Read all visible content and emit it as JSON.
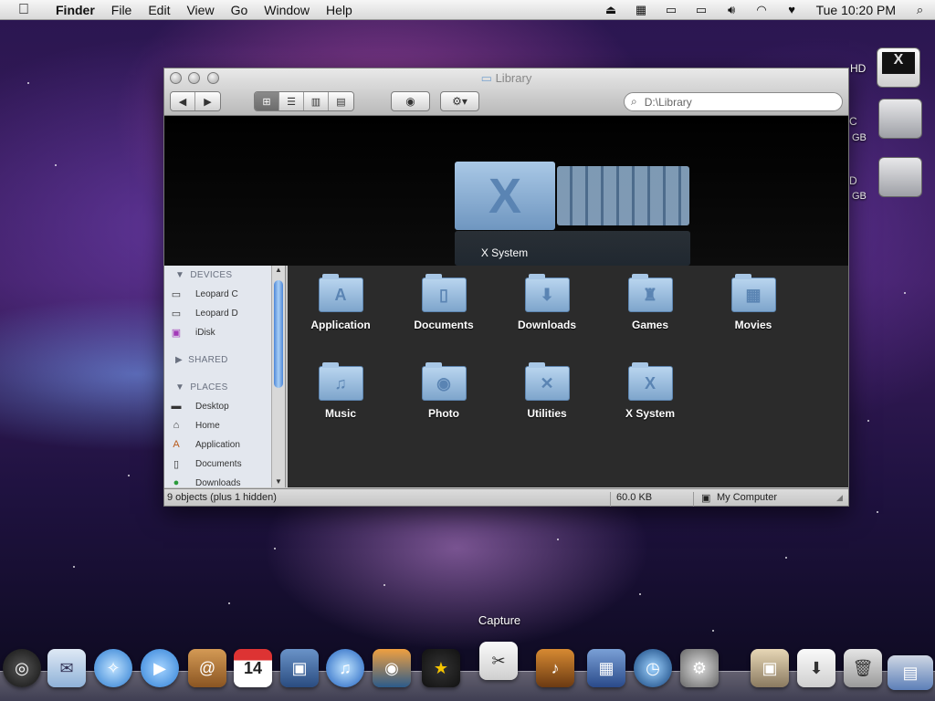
{
  "menubar": {
    "apple_icon": "apple-icon",
    "app": "Finder",
    "items": [
      "File",
      "Edit",
      "View",
      "Go",
      "Window",
      "Help"
    ],
    "clock": "Tue 10:20 PM"
  },
  "desktop": {
    "hd_label": "HD",
    "drive_c_label": "C",
    "drive_c_gb": "GB",
    "drive_d_label": "D",
    "drive_d_gb": "GB"
  },
  "window": {
    "title": "Library",
    "search_value": "D:\\Library",
    "coverflow": {
      "selected": "X System",
      "letter": "X"
    },
    "sidebar": {
      "devices_header": "DEVICES",
      "devices": [
        "Leopard C",
        "Leopard D",
        "iDisk"
      ],
      "shared_header": "SHARED",
      "places_header": "PLACES",
      "places": [
        "Desktop",
        "Home",
        "Application",
        "Documents",
        "Downloads"
      ]
    },
    "items": [
      {
        "label": "Application",
        "glyph": "A"
      },
      {
        "label": "Documents",
        "glyph": "▯"
      },
      {
        "label": "Downloads",
        "glyph": "⬇"
      },
      {
        "label": "Games",
        "glyph": "♜"
      },
      {
        "label": "Movies",
        "glyph": "▦"
      },
      {
        "label": "Music",
        "glyph": "♫"
      },
      {
        "label": "Photo",
        "glyph": "◉"
      },
      {
        "label": "Utilities",
        "glyph": "✕"
      },
      {
        "label": "X System",
        "glyph": "X"
      }
    ],
    "status": {
      "count": "9 objects (plus 1 hidden)",
      "size": "60.0 KB",
      "location": "My Computer"
    }
  },
  "dock": {
    "hover_label": "Capture"
  },
  "colors": {
    "accent": "#4d87d8",
    "folder": "#8fb3d9",
    "grid_bg": "#2b2b2b"
  }
}
